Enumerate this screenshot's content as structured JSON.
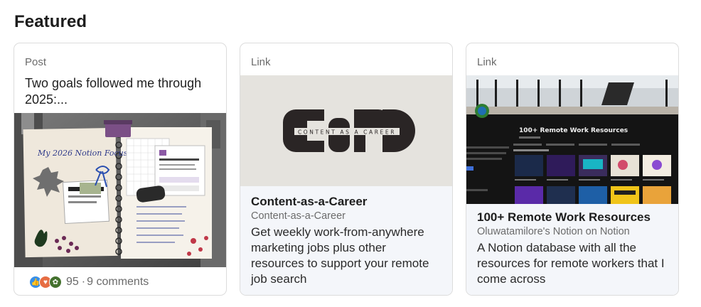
{
  "section": {
    "title": "Featured"
  },
  "cards": [
    {
      "type": "Post",
      "text": "Two goals followed me through 2025:...",
      "image": {
        "notebook_title": "My 2026 Notion Focus",
        "tags": "Notion",
        "side_note": "custom workflows include content on my partnerships and health goals connected to my email to keep track of conversations and deadlines — while my databases help"
      },
      "social": {
        "count": "95",
        "separator": "·",
        "comments": "9 comments"
      }
    },
    {
      "type": "Link",
      "image": {
        "logo_text": "CONTENT AS A CAREER"
      },
      "title": "Content-as-a-Career",
      "subtitle": "Content-as-a-Career",
      "description": "Get weekly work-from-anywhere marketing jobs plus other resources to support your remote job search"
    },
    {
      "type": "Link",
      "image": {
        "heading": "100+ Remote Work Resources"
      },
      "title": "100+ Remote Work Resources",
      "subtitle": "Oluwatamilore's Notion on Notion",
      "description": "A Notion database with all the resources for remote workers that I come across"
    }
  ],
  "colors": {
    "like": "#378fe9",
    "love": "#e66d43",
    "support": "#44712e",
    "link_bg": "#f4f6fa"
  },
  "icons": [
    "like-reaction-icon",
    "love-reaction-icon",
    "support-reaction-icon"
  ]
}
